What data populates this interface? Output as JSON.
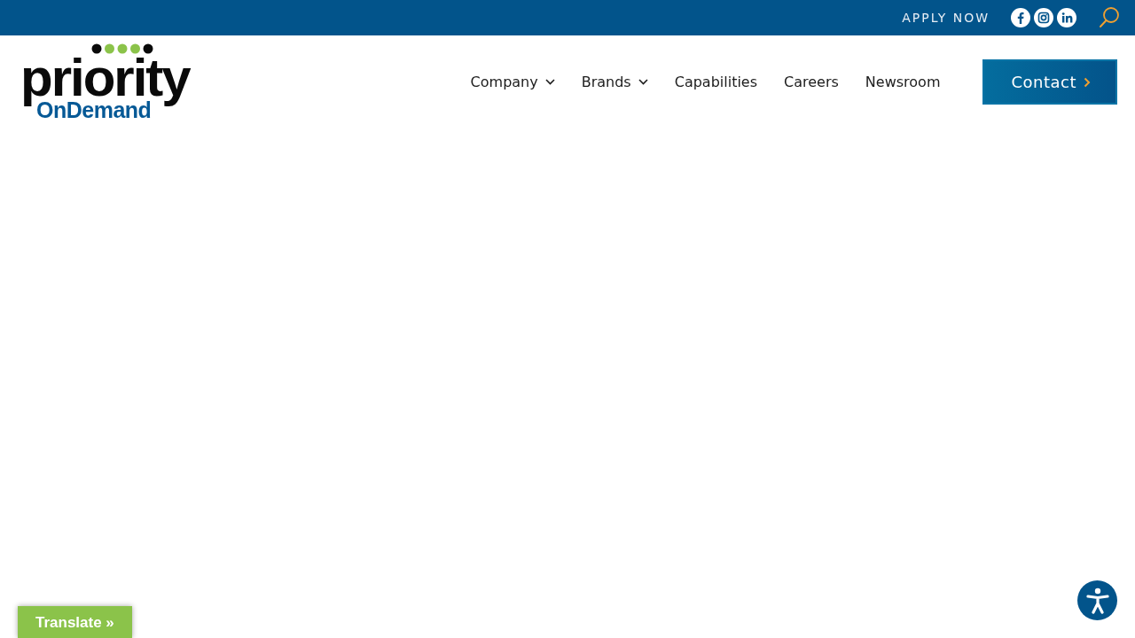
{
  "top_bar": {
    "apply_link": "APPLY NOW",
    "social": [
      {
        "kind": "facebook"
      },
      {
        "kind": "instagram"
      },
      {
        "kind": "linkedin"
      }
    ]
  },
  "logo": {
    "word": "priority",
    "subword": "OnDemand"
  },
  "nav": [
    {
      "label": "Company",
      "dropdown": true
    },
    {
      "label": "Brands",
      "dropdown": true
    },
    {
      "label": "Capabilities",
      "dropdown": false
    },
    {
      "label": "Careers",
      "dropdown": false
    },
    {
      "label": "Newsroom",
      "dropdown": false
    }
  ],
  "contact_button": "Contact",
  "translate_button": "Translate »"
}
